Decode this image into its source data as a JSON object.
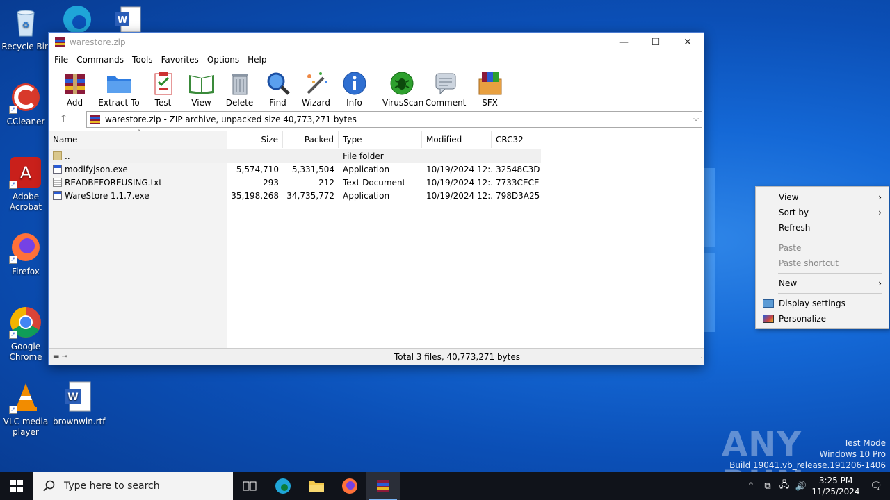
{
  "desktop": {
    "icons": [
      {
        "label": "Recycle Bin"
      },
      {
        "label": "CCleaner"
      },
      {
        "label": "Adobe Acrobat"
      },
      {
        "label": "Firefox"
      },
      {
        "label": "Google Chrome"
      },
      {
        "label": "VLC media player"
      },
      {
        "label": "brownwin.rtf"
      }
    ],
    "watermark": {
      "brand": "ANY RUN",
      "line1": "Test Mode",
      "line2": "Windows 10 Pro",
      "line3": "Build 19041.vb_release.191206-1406"
    }
  },
  "window": {
    "title": "warestore.zip",
    "controls": {
      "minimize": "—",
      "maximize": "☐",
      "close": "✕"
    },
    "menu": [
      "File",
      "Commands",
      "Tools",
      "Favorites",
      "Options",
      "Help"
    ],
    "toolbar": [
      "Add",
      "Extract To",
      "Test",
      "View",
      "Delete",
      "Find",
      "Wizard",
      "Info",
      "VirusScan",
      "Comment",
      "SFX"
    ],
    "address": "warestore.zip - ZIP archive, unpacked size 40,773,271 bytes",
    "columns": {
      "name": "Name",
      "size": "Size",
      "packed": "Packed",
      "type": "Type",
      "modified": "Modified",
      "crc": "CRC32"
    },
    "rows": [
      {
        "name": "..",
        "size": "",
        "packed": "",
        "type": "File folder",
        "modified": "",
        "crc": "",
        "icon": "folder-icon"
      },
      {
        "name": "modifyjson.exe",
        "size": "5,574,710",
        "packed": "5,331,504",
        "type": "Application",
        "modified": "10/19/2024 12:...",
        "crc": "32548C3D",
        "icon": "exe-icon"
      },
      {
        "name": "READBEFOREUSING.txt",
        "size": "293",
        "packed": "212",
        "type": "Text Document",
        "modified": "10/19/2024 12:...",
        "crc": "7733CECE",
        "icon": "txt-icon"
      },
      {
        "name": "WareStore 1.1.7.exe",
        "size": "35,198,268",
        "packed": "34,735,772",
        "type": "Application",
        "modified": "10/19/2024 12:...",
        "crc": "798D3A25",
        "icon": "exe-icon"
      }
    ],
    "status": "Total 3 files, 40,773,271 bytes"
  },
  "context_menu": {
    "items": [
      "View",
      "Sort by",
      "Refresh",
      "Paste",
      "Paste shortcut",
      "New",
      "Display settings",
      "Personalize"
    ]
  },
  "taskbar": {
    "search_placeholder": "Type here to search",
    "time": "3:25 PM",
    "date": "11/25/2024"
  },
  "colors": {
    "accent": "#0b4fb6",
    "taskbar": "#10131a"
  }
}
